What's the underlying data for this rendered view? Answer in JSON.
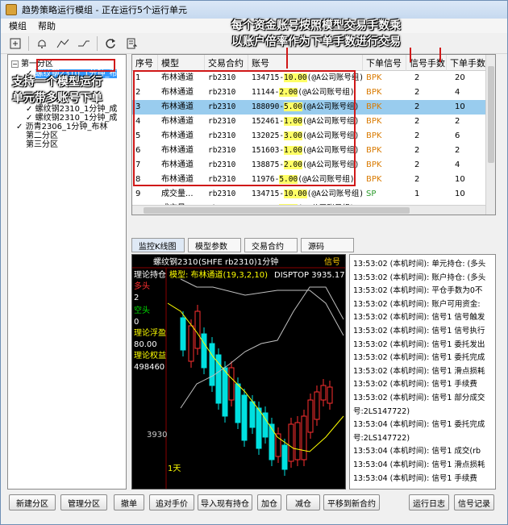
{
  "window": {
    "title": "趋势策略运行模组 - 正在运行5个运行单元"
  },
  "menu": [
    "模组",
    "帮助"
  ],
  "toolbar_icons": [
    "add-icon",
    "bell-icon",
    "trend-up-icon",
    "trend-down-icon",
    "refresh-icon",
    "export-icon"
  ],
  "tree": {
    "nodes": [
      {
        "label": "第一分区",
        "expander": "−"
      },
      {
        "label": "螺纹钢2310_1分钟_布",
        "check": "✓"
      },
      {
        "label": "螺纹钢2310_1分钟_成",
        "check": "✓"
      },
      {
        "label": "螺纹钢2310_1分钟_成",
        "check": "✓"
      },
      {
        "label": "沥青2306_1分钟_布林",
        "check": "✓"
      },
      {
        "label": "第二分区"
      },
      {
        "label": "第三分区"
      }
    ]
  },
  "grid": {
    "columns": [
      "序号",
      "模型",
      "交易合约",
      "账号",
      "下单信号",
      "信号手数",
      "下单手数"
    ],
    "rows": [
      {
        "no": "1",
        "model": "布林通道",
        "contract": "rb2310",
        "acc_pre": "134715-",
        "mult": "10.00",
        "acc_post": "(@A公司账号组)",
        "signal": "BPK",
        "sig_qty": "2",
        "order_qty": "20"
      },
      {
        "no": "2",
        "model": "布林通道",
        "contract": "rb2310",
        "acc_pre": "11144-",
        "mult": "2.00",
        "acc_post": "(@A公司账号组)",
        "signal": "BPK",
        "sig_qty": "2",
        "order_qty": "4"
      },
      {
        "no": "3",
        "model": "布林通道",
        "contract": "rb2310",
        "acc_pre": "188090-",
        "mult": "5.00",
        "acc_post": "(@A公司账号组)",
        "signal": "BPK",
        "sig_qty": "2",
        "order_qty": "10"
      },
      {
        "no": "4",
        "model": "布林通道",
        "contract": "rb2310",
        "acc_pre": "152461-",
        "mult": "1.00",
        "acc_post": "(@A公司账号组)",
        "signal": "BPK",
        "sig_qty": "2",
        "order_qty": "2"
      },
      {
        "no": "5",
        "model": "布林通道",
        "contract": "rb2310",
        "acc_pre": "132025-",
        "mult": "3.00",
        "acc_post": "(@A公司账号组)",
        "signal": "BPK",
        "sig_qty": "2",
        "order_qty": "6"
      },
      {
        "no": "6",
        "model": "布林通道",
        "contract": "rb2310",
        "acc_pre": "151603-",
        "mult": "1.00",
        "acc_post": "(@A公司账号组)",
        "signal": "BPK",
        "sig_qty": "2",
        "order_qty": "2"
      },
      {
        "no": "7",
        "model": "布林通道",
        "contract": "rb2310",
        "acc_pre": "138875-",
        "mult": "2.00",
        "acc_post": "(@A公司账号组)",
        "signal": "BPK",
        "sig_qty": "2",
        "order_qty": "4"
      },
      {
        "no": "8",
        "model": "布林通道",
        "contract": "rb2310",
        "acc_pre": "11976-",
        "mult": "5.00",
        "acc_post": "(@A公司账号组)",
        "signal": "BPK",
        "sig_qty": "2",
        "order_qty": "10"
      },
      {
        "no": "9",
        "model": "成交量...",
        "contract": "rb2310",
        "acc_pre": "134715-",
        "mult": "10.00",
        "acc_post": "(@A公司账号组)",
        "signal": "SP",
        "sig_qty": "1",
        "order_qty": "10"
      },
      {
        "no": "10",
        "model": "成交量...",
        "contract": "rb2310",
        "acc_pre": "11144-",
        "mult": "2.00",
        "acc_post": "(@A公司账号组)",
        "signal": "SP",
        "sig_qty": "1",
        "order_qty": "2"
      }
    ]
  },
  "tabs": [
    "监控K线图",
    "模型参数",
    "交易合约",
    "源码"
  ],
  "chart": {
    "header": "螺纹钢2310",
    "header2": "(SHFE rb2310)1分钟",
    "signal_tag": "信号",
    "model_label": "模型: 布林通道(19,3,2,10)",
    "disptop": "DISPTOP 3935.17",
    "side": {
      "theory_pos": "理论持仓",
      "long": "多头",
      "long_val": "2",
      "short": "空头",
      "short_val": "0",
      "float_pnl": "理论浮盈",
      "float_val": "80.00",
      "equity": "理论权益",
      "equity_val": "498460"
    },
    "price_label": "3930",
    "period_label": "1天"
  },
  "log": [
    "13:53:02 (本机时间): 单元持仓: (多头",
    "13:53:02 (本机时间): 账户持仓: (多头",
    "13:53:02 (本机时间): 平仓手数为0不",
    "13:53:02 (本机时间): 账户可用资金: ",
    "13:53:02 (本机时间): 信号1 信号触发",
    "13:53:02 (本机时间): 信号1 信号执行",
    "13:53:02 (本机时间): 信号1 委托发出",
    "13:53:02 (本机时间): 信号1 委托完成",
    "13:53:02 (本机时间): 信号1 滑点损耗",
    "13:53:02 (本机时间): 信号1 手续费",
    "13:53:02 (本机时间): 信号1 部分成交",
    "号:2LS147722)",
    "13:53:04 (本机时间): 信号1 委托完成",
    "号:2LS147722)",
    "13:53:04 (本机时间): 信号1 成交(rb",
    "13:53:04 (本机时间): 信号1 滑点损耗",
    "13:53:04 (本机时间): 信号1 手续费"
  ],
  "buttons": [
    "新建分区",
    "管理分区",
    "撤单",
    "追对手价",
    "导入现有持仓",
    "加仓",
    "减仓",
    "平移到新合约",
    "运行日志",
    "信号记录"
  ],
  "annotations": {
    "top_line1": "每个资金账号按照模型交易手数乘",
    "top_line2": "以账户倍率作为下单手数进行交易",
    "left_line1": "支持一个模型运行",
    "left_line2": "单元带多账号下单"
  }
}
